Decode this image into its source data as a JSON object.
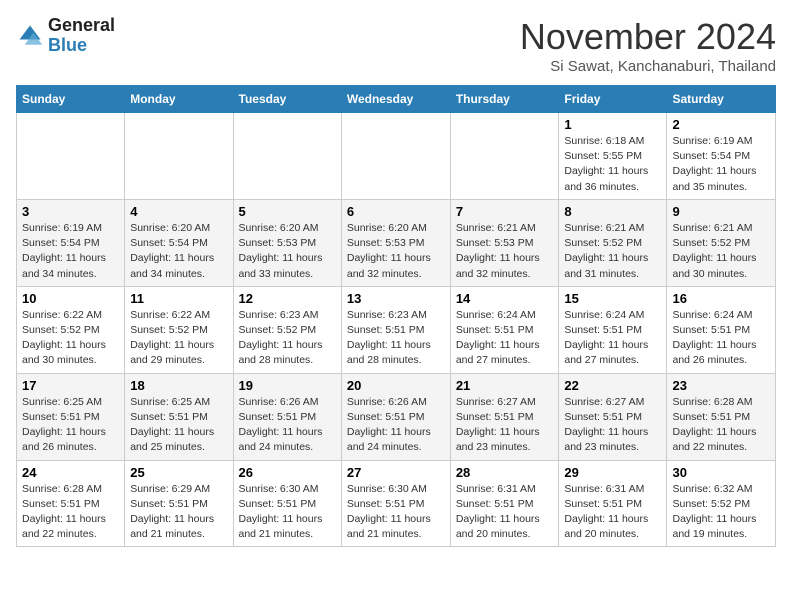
{
  "logo": {
    "line1": "General",
    "line2": "Blue"
  },
  "title": "November 2024",
  "location": "Si Sawat, Kanchanaburi, Thailand",
  "weekdays": [
    "Sunday",
    "Monday",
    "Tuesday",
    "Wednesday",
    "Thursday",
    "Friday",
    "Saturday"
  ],
  "weeks": [
    [
      {
        "day": "",
        "detail": ""
      },
      {
        "day": "",
        "detail": ""
      },
      {
        "day": "",
        "detail": ""
      },
      {
        "day": "",
        "detail": ""
      },
      {
        "day": "",
        "detail": ""
      },
      {
        "day": "1",
        "detail": "Sunrise: 6:18 AM\nSunset: 5:55 PM\nDaylight: 11 hours\nand 36 minutes."
      },
      {
        "day": "2",
        "detail": "Sunrise: 6:19 AM\nSunset: 5:54 PM\nDaylight: 11 hours\nand 35 minutes."
      }
    ],
    [
      {
        "day": "3",
        "detail": "Sunrise: 6:19 AM\nSunset: 5:54 PM\nDaylight: 11 hours\nand 34 minutes."
      },
      {
        "day": "4",
        "detail": "Sunrise: 6:20 AM\nSunset: 5:54 PM\nDaylight: 11 hours\nand 34 minutes."
      },
      {
        "day": "5",
        "detail": "Sunrise: 6:20 AM\nSunset: 5:53 PM\nDaylight: 11 hours\nand 33 minutes."
      },
      {
        "day": "6",
        "detail": "Sunrise: 6:20 AM\nSunset: 5:53 PM\nDaylight: 11 hours\nand 32 minutes."
      },
      {
        "day": "7",
        "detail": "Sunrise: 6:21 AM\nSunset: 5:53 PM\nDaylight: 11 hours\nand 32 minutes."
      },
      {
        "day": "8",
        "detail": "Sunrise: 6:21 AM\nSunset: 5:52 PM\nDaylight: 11 hours\nand 31 minutes."
      },
      {
        "day": "9",
        "detail": "Sunrise: 6:21 AM\nSunset: 5:52 PM\nDaylight: 11 hours\nand 30 minutes."
      }
    ],
    [
      {
        "day": "10",
        "detail": "Sunrise: 6:22 AM\nSunset: 5:52 PM\nDaylight: 11 hours\nand 30 minutes."
      },
      {
        "day": "11",
        "detail": "Sunrise: 6:22 AM\nSunset: 5:52 PM\nDaylight: 11 hours\nand 29 minutes."
      },
      {
        "day": "12",
        "detail": "Sunrise: 6:23 AM\nSunset: 5:52 PM\nDaylight: 11 hours\nand 28 minutes."
      },
      {
        "day": "13",
        "detail": "Sunrise: 6:23 AM\nSunset: 5:51 PM\nDaylight: 11 hours\nand 28 minutes."
      },
      {
        "day": "14",
        "detail": "Sunrise: 6:24 AM\nSunset: 5:51 PM\nDaylight: 11 hours\nand 27 minutes."
      },
      {
        "day": "15",
        "detail": "Sunrise: 6:24 AM\nSunset: 5:51 PM\nDaylight: 11 hours\nand 27 minutes."
      },
      {
        "day": "16",
        "detail": "Sunrise: 6:24 AM\nSunset: 5:51 PM\nDaylight: 11 hours\nand 26 minutes."
      }
    ],
    [
      {
        "day": "17",
        "detail": "Sunrise: 6:25 AM\nSunset: 5:51 PM\nDaylight: 11 hours\nand 26 minutes."
      },
      {
        "day": "18",
        "detail": "Sunrise: 6:25 AM\nSunset: 5:51 PM\nDaylight: 11 hours\nand 25 minutes."
      },
      {
        "day": "19",
        "detail": "Sunrise: 6:26 AM\nSunset: 5:51 PM\nDaylight: 11 hours\nand 24 minutes."
      },
      {
        "day": "20",
        "detail": "Sunrise: 6:26 AM\nSunset: 5:51 PM\nDaylight: 11 hours\nand 24 minutes."
      },
      {
        "day": "21",
        "detail": "Sunrise: 6:27 AM\nSunset: 5:51 PM\nDaylight: 11 hours\nand 23 minutes."
      },
      {
        "day": "22",
        "detail": "Sunrise: 6:27 AM\nSunset: 5:51 PM\nDaylight: 11 hours\nand 23 minutes."
      },
      {
        "day": "23",
        "detail": "Sunrise: 6:28 AM\nSunset: 5:51 PM\nDaylight: 11 hours\nand 22 minutes."
      }
    ],
    [
      {
        "day": "24",
        "detail": "Sunrise: 6:28 AM\nSunset: 5:51 PM\nDaylight: 11 hours\nand 22 minutes."
      },
      {
        "day": "25",
        "detail": "Sunrise: 6:29 AM\nSunset: 5:51 PM\nDaylight: 11 hours\nand 21 minutes."
      },
      {
        "day": "26",
        "detail": "Sunrise: 6:30 AM\nSunset: 5:51 PM\nDaylight: 11 hours\nand 21 minutes."
      },
      {
        "day": "27",
        "detail": "Sunrise: 6:30 AM\nSunset: 5:51 PM\nDaylight: 11 hours\nand 21 minutes."
      },
      {
        "day": "28",
        "detail": "Sunrise: 6:31 AM\nSunset: 5:51 PM\nDaylight: 11 hours\nand 20 minutes."
      },
      {
        "day": "29",
        "detail": "Sunrise: 6:31 AM\nSunset: 5:51 PM\nDaylight: 11 hours\nand 20 minutes."
      },
      {
        "day": "30",
        "detail": "Sunrise: 6:32 AM\nSunset: 5:52 PM\nDaylight: 11 hours\nand 19 minutes."
      }
    ]
  ]
}
